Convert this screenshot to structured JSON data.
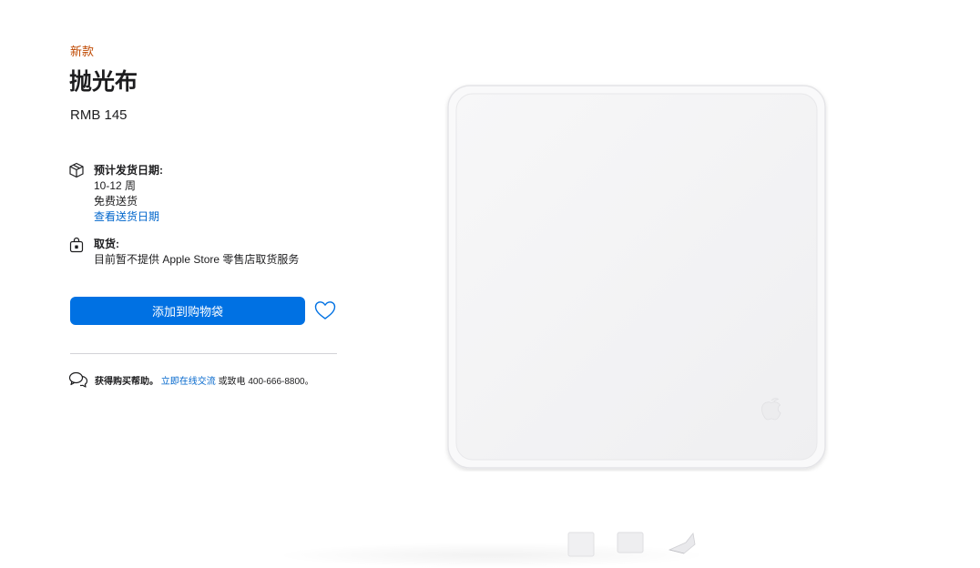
{
  "product": {
    "badge": "新款",
    "name": "抛光布",
    "price": "RMB 145",
    "image_icon": "apple-logo-icon"
  },
  "shipping": {
    "icon": "box-icon",
    "heading": "预计发货日期:",
    "eta": "10-12 周",
    "note": "免费送货",
    "link": "查看送货日期"
  },
  "pickup": {
    "icon": "shopping-bag-icon",
    "heading": "取货:",
    "note": "目前暂不提供 Apple Store 零售店取货服务"
  },
  "actions": {
    "add_to_bag": "添加到购物袋",
    "favorite_icon": "heart-icon"
  },
  "help": {
    "icon": "chat-bubbles-icon",
    "label": "获得购买帮助。",
    "link": "立即在线交流",
    "suffix": "或致电 400-666-8800。"
  },
  "colors": {
    "badge": "#bf4800",
    "accent": "#0071e3",
    "link": "#0066cc",
    "text": "#1d1d1f"
  }
}
